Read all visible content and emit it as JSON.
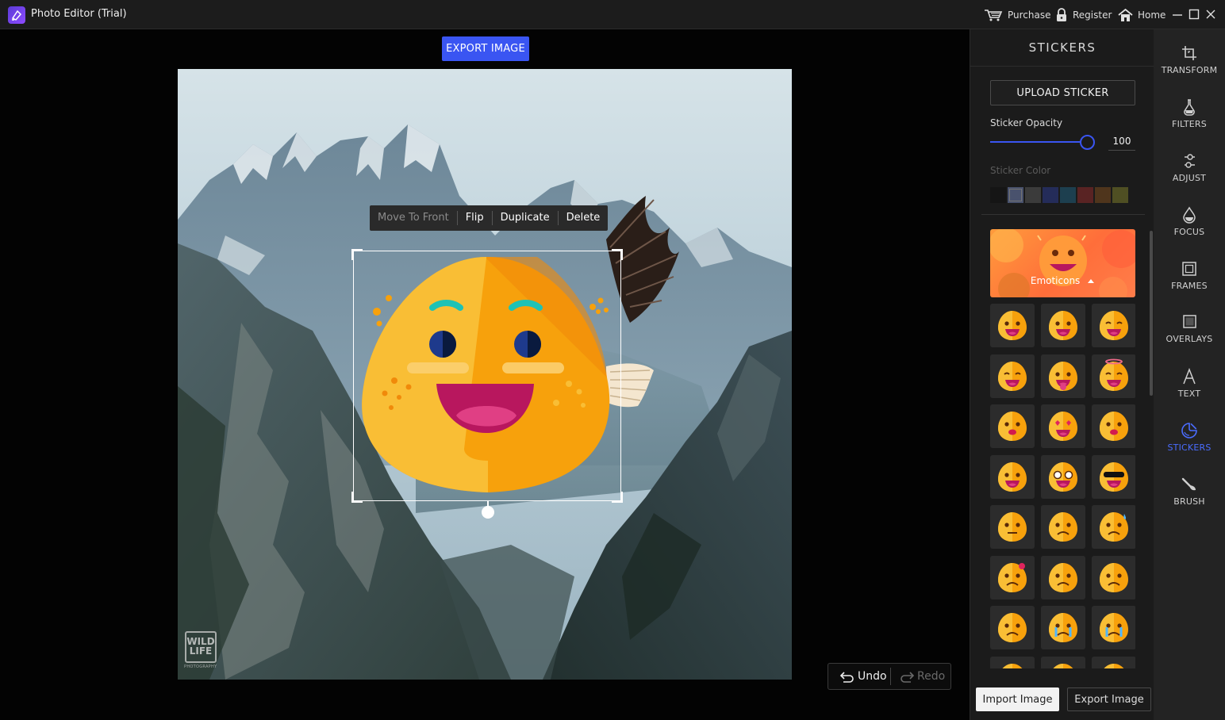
{
  "window": {
    "title": "Photo Editor (Trial)",
    "purchase": "Purchase",
    "register": "Register",
    "home": "Home"
  },
  "canvas": {
    "export_label": "EXPORT IMAGE",
    "watermark_line1": "WILD",
    "watermark_line2": "LIFE",
    "watermark_sub": "PHOTOGRAPHY",
    "context_menu": [
      "Move To Front",
      "Flip",
      "Duplicate",
      "Delete"
    ],
    "undo_label": "Undo",
    "redo_label": "Redo"
  },
  "panel": {
    "title": "STICKERS",
    "upload_label": "UPLOAD STICKER",
    "opacity_label": "Sticker Opacity",
    "opacity_value": "100",
    "opacity_fraction": 1.0,
    "color_label": "Sticker Color",
    "swatches": [
      "#111111",
      "#6f7fb0",
      "#555555",
      "#2c3a8c",
      "#1f5d7a",
      "#8c2a2a",
      "#7a4a1e",
      "#7a7a2a"
    ],
    "category_label": "Emoticons",
    "import_label": "Import Image",
    "export_label": "Export Image"
  },
  "tools": [
    {
      "label": "TRANSFORM",
      "icon": "crop-icon"
    },
    {
      "label": "FILTERS",
      "icon": "flask-icon"
    },
    {
      "label": "ADJUST",
      "icon": "adjust-icon"
    },
    {
      "label": "FOCUS",
      "icon": "drop-icon"
    },
    {
      "label": "FRAMES",
      "icon": "frame-icon"
    },
    {
      "label": "OVERLAYS",
      "icon": "overlay-icon"
    },
    {
      "label": "TEXT",
      "icon": "text-icon"
    },
    {
      "label": "STICKERS",
      "icon": "sticker-icon",
      "active": true
    },
    {
      "label": "BRUSH",
      "icon": "brush-icon"
    }
  ],
  "colors": {
    "accent": "#3a55f2",
    "sticker_orange": "#f7a10c",
    "sticker_light": "#f9be35"
  }
}
